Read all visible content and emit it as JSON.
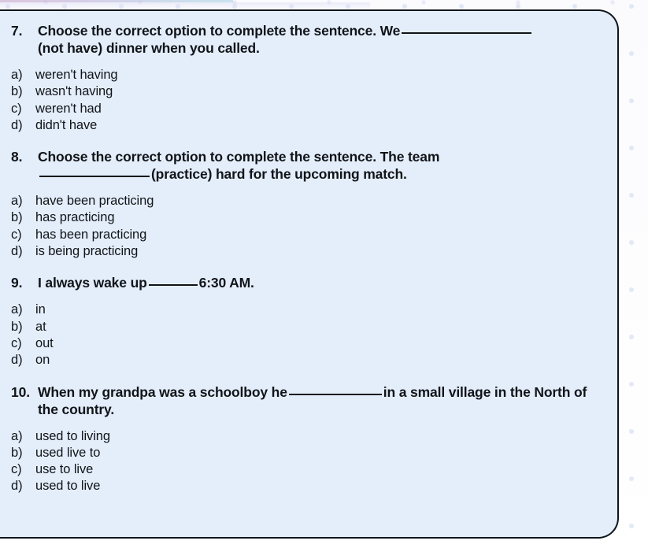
{
  "worksheet": {
    "background_color": "#e4eefb",
    "border_color": "#10161c",
    "questions": [
      {
        "number": "7.",
        "text_before": "Choose the correct option to complete the sentence. We",
        "text_after": "(not have) dinner when you called.",
        "blank_size": "w-xl",
        "justified": false,
        "options": [
          {
            "letter": "a)",
            "text": "weren't having"
          },
          {
            "letter": "b)",
            "text": "wasn't having"
          },
          {
            "letter": "c)",
            "text": "weren't had"
          },
          {
            "letter": "d)",
            "text": "didn't have"
          }
        ]
      },
      {
        "number": "8.",
        "text_before": "Choose the correct option to complete the sentence. The team",
        "text_after": "(practice) hard for the upcoming match.",
        "blank_size": "w-lg",
        "justified": true,
        "options": [
          {
            "letter": "a)",
            "text": "have been practicing"
          },
          {
            "letter": "b)",
            "text": "has practicing"
          },
          {
            "letter": "c)",
            "text": "has been practicing"
          },
          {
            "letter": "d)",
            "text": "is being practicing"
          }
        ]
      },
      {
        "number": "9.",
        "text_before": "I always wake up",
        "text_after": "6:30 AM.",
        "blank_size": "w-sm",
        "justified": false,
        "options": [
          {
            "letter": "a)",
            "text": "in"
          },
          {
            "letter": "b)",
            "text": "at"
          },
          {
            "letter": "c)",
            "text": "out"
          },
          {
            "letter": "d)",
            "text": "on"
          }
        ]
      },
      {
        "number": "10.",
        "text_before": "When my grandpa was a schoolboy he",
        "text_after": "in a small village in the North of the country.",
        "blank_size": "w-md",
        "justified": false,
        "options": [
          {
            "letter": "a)",
            "text": "used to living"
          },
          {
            "letter": "b)",
            "text": "used live to"
          },
          {
            "letter": "c)",
            "text": "use to live"
          },
          {
            "letter": "d)",
            "text": "used to live"
          }
        ]
      }
    ]
  }
}
